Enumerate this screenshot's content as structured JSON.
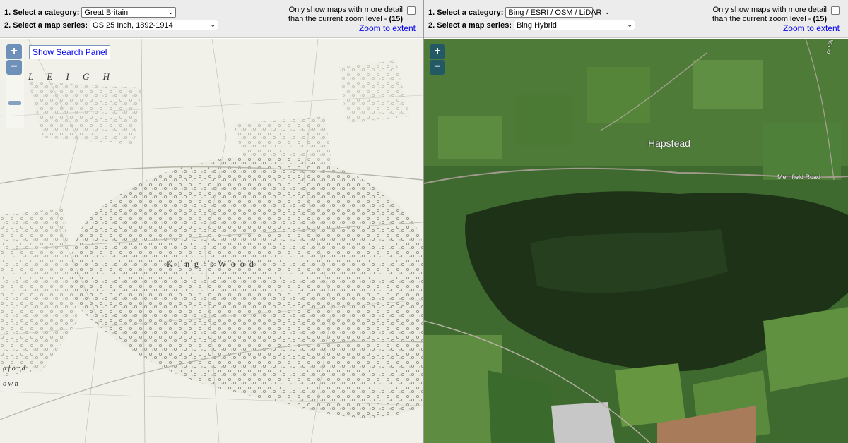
{
  "left": {
    "category_label": "1. Select a category:",
    "category_value": "Great Britain",
    "series_label": "2. Select a map series:",
    "series_value": "OS 25 Inch, 1892-1914",
    "detail_line1": "Only show maps with more detail",
    "detail_line2_prefix": "than the current zoom level - ",
    "zoom_level": "(15)",
    "zoom_extent": "Zoom to extent",
    "zoom_in": "+",
    "zoom_out": "−",
    "search_panel": "Show Search Panel",
    "map_labels": {
      "kings_wood": "K i n g ' s   W o o d",
      "leigh": "L E I G H",
      "aford": "a f o r d",
      "own": "o w n"
    }
  },
  "right": {
    "category_label": "1. Select a category:",
    "category_value": "Bing / ESRI / OSM / LiDAR",
    "series_value": "Bing Hybrid",
    "series_label": "2. Select a map series:",
    "detail_line1": "Only show maps with more detail",
    "detail_line2_prefix": "than the current zoom level - ",
    "zoom_level": "(15)",
    "zoom_extent": "Zoom to extent",
    "zoom_in": "+",
    "zoom_out": "−",
    "map_labels": {
      "hapstead": "Hapstead",
      "merrifield_road": "Merrifield Road",
      "hill": "or Hill"
    }
  },
  "icons": {
    "dropdown": "chevron-down-icon",
    "checkbox": "checkbox-icon"
  }
}
